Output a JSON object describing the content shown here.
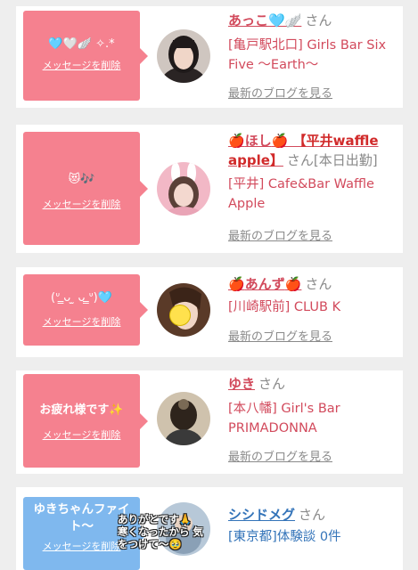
{
  "cards": [
    {
      "message": "🩵🤍🪽 ✧.*",
      "delete_label": "メッセージを削除",
      "name": "あっこ🩵🪽",
      "san": "さん",
      "shop": "[亀戸駅北口] Girls Bar Six Five 〜Earth〜",
      "blog_label": "最新のブログを見る"
    },
    {
      "message": "😻🎶",
      "delete_label": "メッセージを削除",
      "name_prefix": "🍎",
      "name_mid": "ほし",
      "name_suffix": "🍎 【平井waffle apple】",
      "san": "さん[本日出勤]",
      "shop": "[平井] Cafe&Bar Waffle Apple",
      "blog_label": "最新のブログを見る"
    },
    {
      "message": "(ᐡ ̳ᴗ  ̫ ᴗ ̳ᐡ)🩵",
      "delete_label": "メッセージを削除",
      "name_prefix": "🍎",
      "name_mid": "あんず",
      "name_suffix": "🍎",
      "san": "さん",
      "shop": "[川崎駅前] CLUB K",
      "blog_label": "最新のブログを見る"
    },
    {
      "message": "お疲れ様です✨",
      "delete_label": "メッセージを削除",
      "name": "ゆき",
      "san": "さん",
      "shop": "[本八幡] Girl's Bar PRIMADONNA",
      "blog_label": "最新のブログを見る"
    },
    {
      "message": "ゆきちゃんファイト〜",
      "delete_label": "メッセージを削除",
      "name": "シシドメグ",
      "san": "さん",
      "shop": "[東京都]体験談 0件",
      "overlay": "ありがとです🙏 寒くなったから 気をつけて〜🥹"
    }
  ]
}
